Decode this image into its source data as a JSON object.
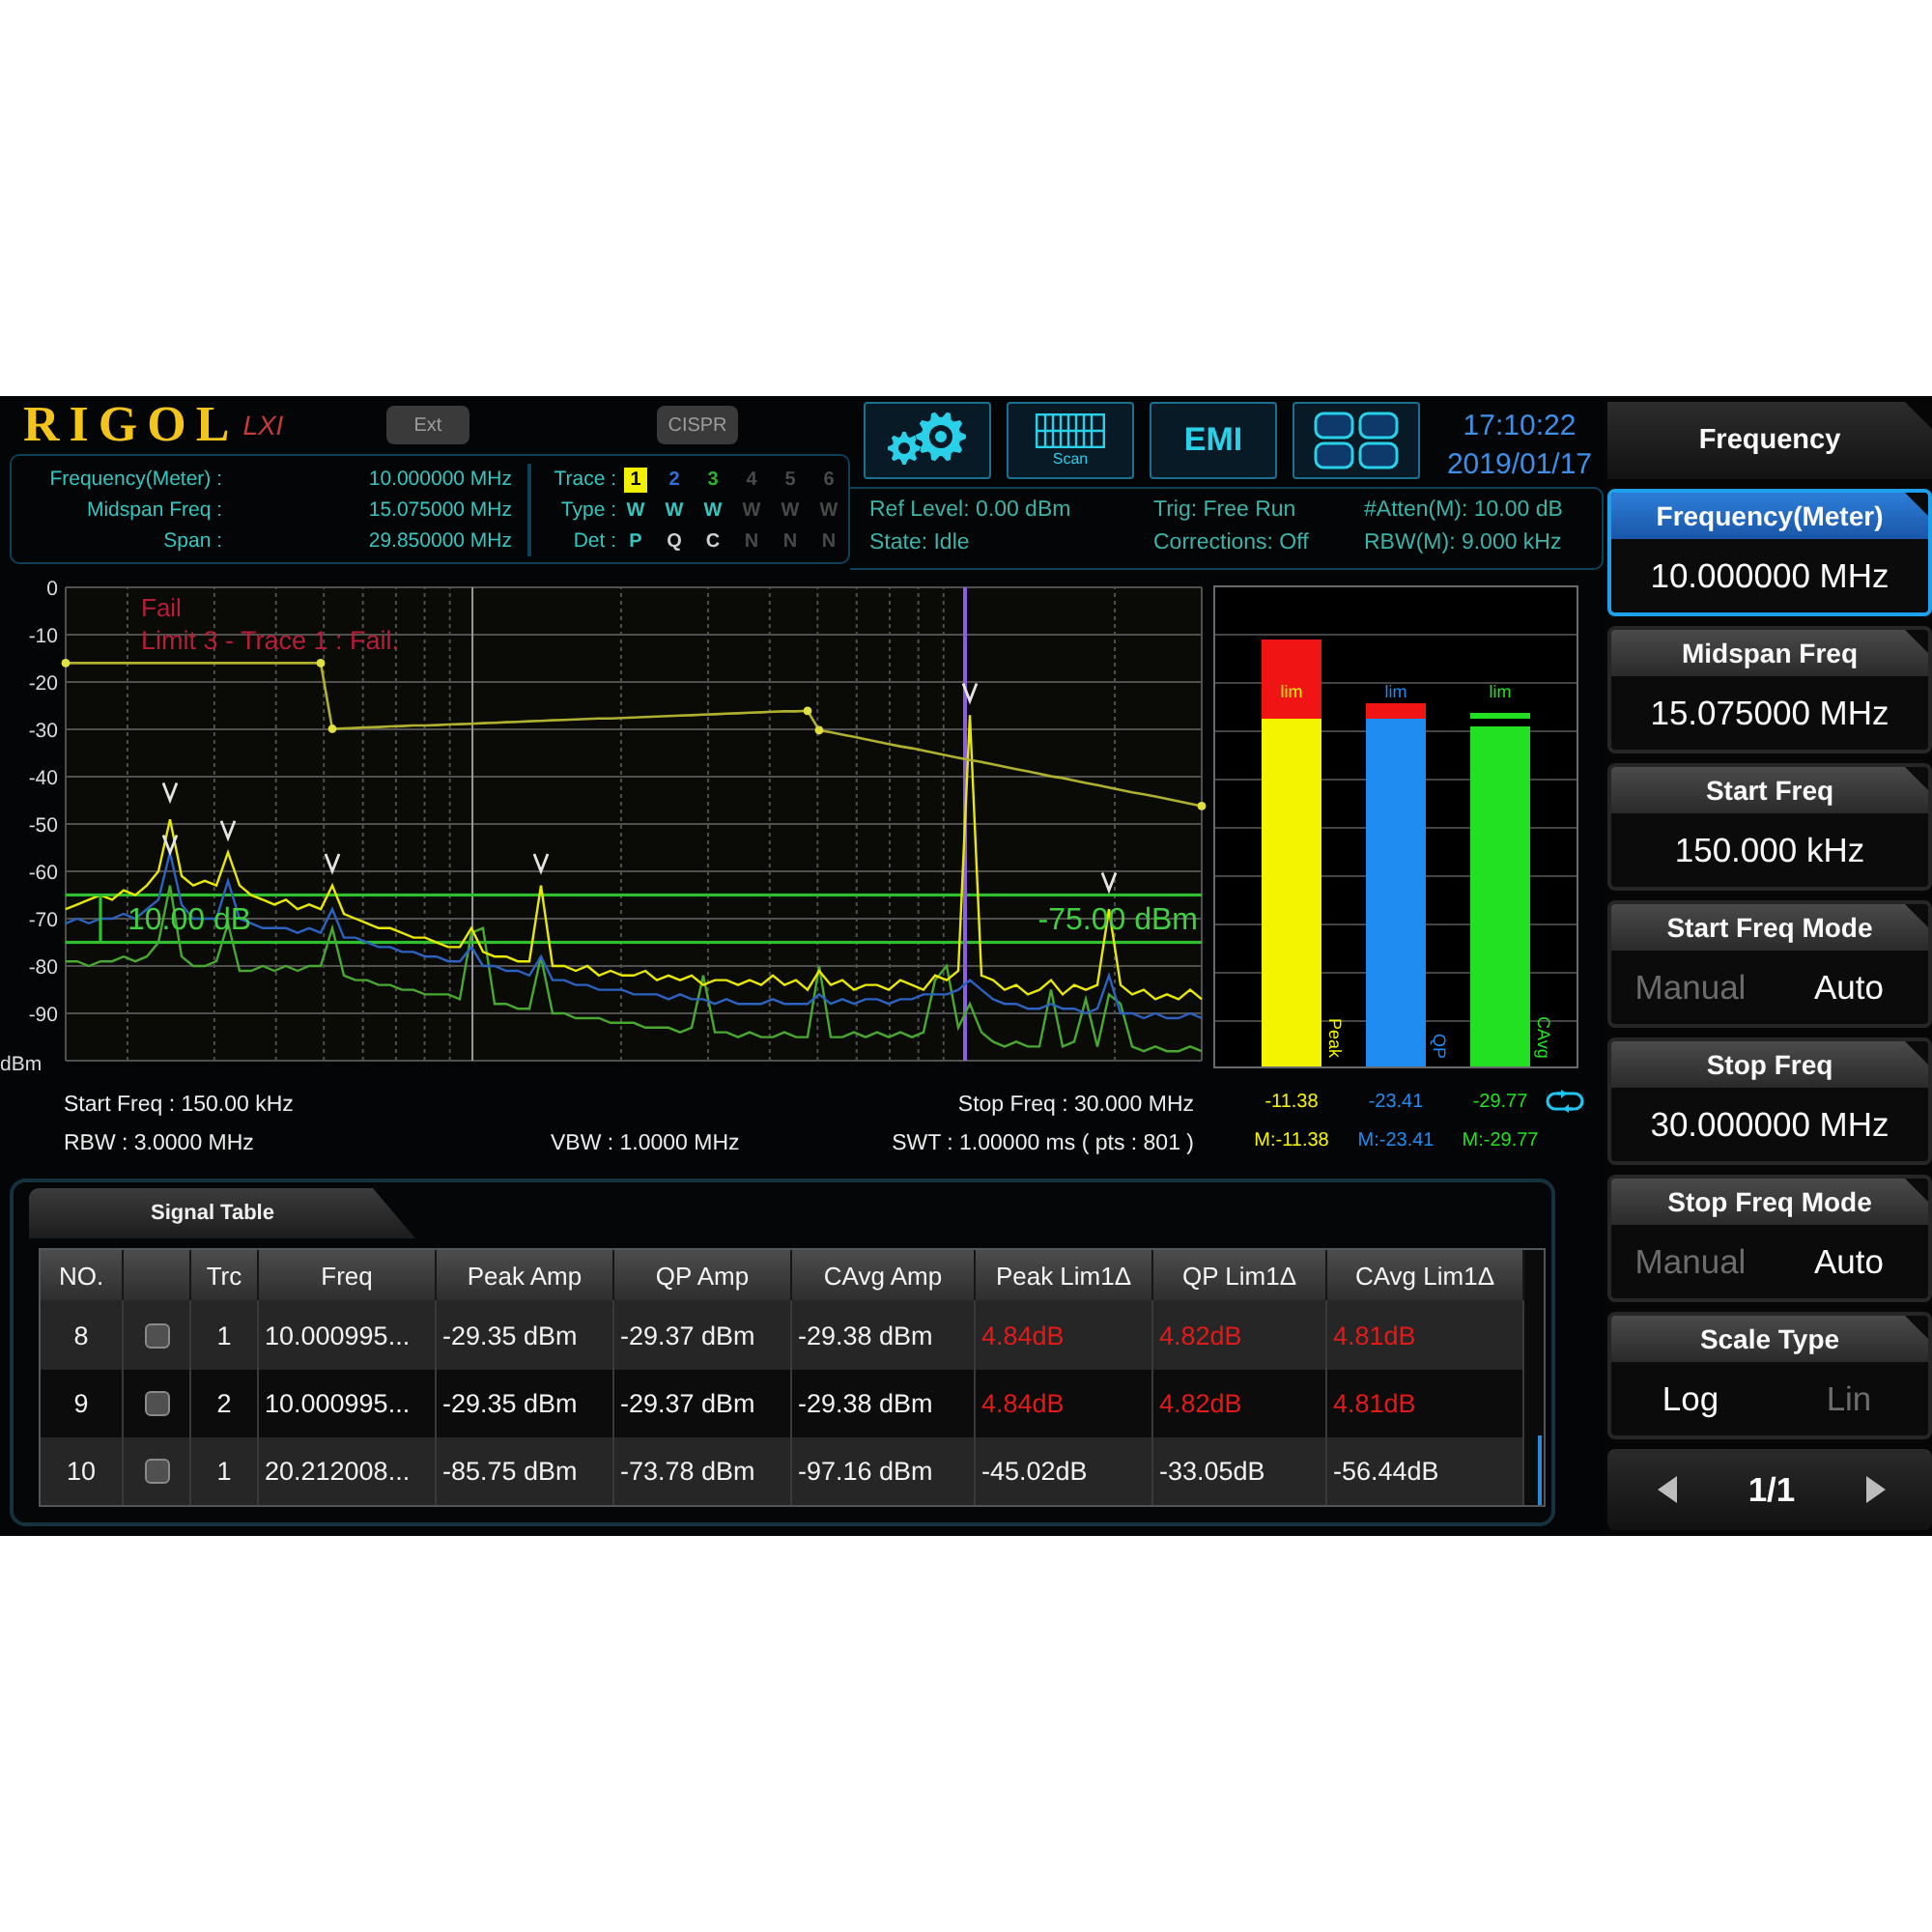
{
  "header": {
    "logo": {
      "brand": "RIGOL",
      "mark": "LXI"
    },
    "mode_buttons": [
      {
        "label": "Ext"
      },
      {
        "label": "CISPR"
      }
    ],
    "toolbar": [
      {
        "kind": "settings"
      },
      {
        "kind": "scan",
        "label": "Scan"
      },
      {
        "kind": "text",
        "label": "EMI"
      },
      {
        "kind": "layout"
      }
    ],
    "clock": {
      "time": "17:10:22",
      "date": "2019/01/17"
    },
    "readouts": [
      {
        "label": "Frequency(Meter) :",
        "value": "10.000000 MHz"
      },
      {
        "label": "Midspan Freq :",
        "value": "15.075000 MHz"
      },
      {
        "label": "Span :",
        "value": "29.850000 MHz"
      }
    ],
    "trace_table": {
      "row_labels": [
        "Trace :",
        "Type :",
        "Det :"
      ],
      "traces": [
        {
          "number": "1",
          "type": "W",
          "detector": "P",
          "color": "#f0f000",
          "on": true,
          "selected": true
        },
        {
          "number": "2",
          "type": "W",
          "detector": "Q",
          "color": "#2f6fd8",
          "on": true,
          "selected": false
        },
        {
          "number": "3",
          "type": "W",
          "detector": "C",
          "color": "#30b030",
          "on": true,
          "selected": false
        },
        {
          "number": "4",
          "type": "W",
          "detector": "N",
          "on": false,
          "selected": false
        },
        {
          "number": "5",
          "type": "W",
          "detector": "N",
          "on": false,
          "selected": false
        },
        {
          "number": "6",
          "type": "W",
          "detector": "N",
          "on": false,
          "selected": false
        }
      ]
    },
    "status": [
      [
        "Ref Level: 0.00 dBm",
        "State: Idle"
      ],
      [
        "Trig: Free Run",
        "Corrections: Off"
      ],
      [
        "#Atten(M): 10.00 dB",
        "RBW(M): 9.000 kHz"
      ]
    ]
  },
  "spectrum": {
    "verdict": "Fail",
    "limit_message": "Limit 3 - Trace 1 : Fail.",
    "delta_readout": "10.00 dB",
    "threshold_readout": "-75.00 dBm",
    "start_freq": "Start Freq : 150.00 kHz",
    "stop_freq": "Stop Freq : 30.000 MHz",
    "rbw": "RBW : 3.0000 MHz",
    "vbw": "VBW : 1.0000 MHz",
    "sweep": "SWT : 1.00000 ms ( pts : 801 )",
    "chart_data": {
      "type": "line",
      "ylabel": "dBm",
      "ylim": [
        -100,
        0
      ],
      "yticks": [
        0,
        -10,
        -20,
        -30,
        -40,
        -50,
        -60,
        -70,
        -80,
        -90
      ],
      "ref_lines": [
        {
          "axis": "y",
          "value": -65,
          "color": "#2fc02f"
        },
        {
          "axis": "y",
          "value": -75,
          "color": "#2fc02f"
        }
      ],
      "categories": [
        null,
        null,
        null,
        null,
        null,
        null,
        null,
        null,
        null,
        null,
        null,
        null,
        null,
        null,
        null,
        null,
        null,
        null,
        null,
        null,
        null,
        null,
        null,
        null,
        null,
        null,
        null,
        null,
        null,
        null,
        null,
        null,
        null,
        null,
        null,
        null,
        null,
        null,
        null,
        null,
        null,
        null,
        null,
        null,
        null,
        null,
        null,
        null,
        null,
        null,
        null,
        null,
        null,
        null,
        null,
        null,
        null,
        null,
        null,
        null,
        null,
        null,
        null,
        null,
        null,
        null,
        null,
        null,
        null,
        null,
        null,
        null,
        null,
        null,
        null,
        null,
        null,
        null,
        null,
        null,
        null,
        null,
        null,
        null,
        null,
        null,
        null,
        null,
        null,
        null,
        null,
        null,
        null,
        null,
        null,
        null,
        null,
        null,
        null
      ],
      "series": [
        {
          "color": "#48a830",
          "values": [
            -79,
            -79,
            -80,
            -79,
            -79,
            -78,
            -79,
            -78,
            -75,
            -63,
            -78,
            -80,
            -80,
            -79,
            -71,
            -81,
            -81,
            -80,
            -81,
            -80,
            -81,
            -80,
            -80,
            -72,
            -82,
            -83,
            -83,
            -84,
            -84,
            -85,
            -85,
            -86,
            -86,
            -86,
            -87,
            -73,
            -72,
            -88,
            -88,
            -89,
            -89,
            -78,
            -90,
            -90,
            -91,
            -91,
            -91,
            -92,
            -92,
            -92,
            -93,
            -93,
            -93,
            -94,
            -93,
            -82,
            -94,
            -94,
            -95,
            -94,
            -95,
            -95,
            -94,
            -95,
            -95,
            -80,
            -95,
            -95,
            -94,
            -95,
            -94,
            -95,
            -94,
            -95,
            -94,
            -83,
            -80,
            -93,
            -88,
            -94,
            -96,
            -97,
            -96,
            -97,
            -97,
            -85,
            -97,
            -96,
            -87,
            -97,
            -86,
            -88,
            -97,
            -98,
            -97,
            -98,
            -98,
            -97,
            -98
          ]
        },
        {
          "color": "#2c62c0",
          "values": [
            -71,
            -70,
            -71,
            -70,
            -70,
            -69,
            -70,
            -68,
            -66,
            -56,
            -67,
            -70,
            -70,
            -70,
            -62,
            -70,
            -71,
            -72,
            -72,
            -72,
            -73,
            -72,
            -73,
            -68,
            -74,
            -74,
            -75,
            -76,
            -76,
            -77,
            -77,
            -78,
            -78,
            -79,
            -79,
            -76,
            -80,
            -80,
            -81,
            -81,
            -82,
            -78,
            -83,
            -83,
            -84,
            -84,
            -85,
            -85,
            -85,
            -86,
            -86,
            -86,
            -87,
            -86,
            -87,
            -87,
            -88,
            -87,
            -88,
            -88,
            -88,
            -87,
            -88,
            -88,
            -88,
            -86,
            -88,
            -87,
            -88,
            -87,
            -87,
            -88,
            -87,
            -87,
            -86,
            -86,
            -86,
            -85,
            -83,
            -85,
            -87,
            -88,
            -88,
            -89,
            -89,
            -88,
            -89,
            -89,
            -90,
            -89,
            -82,
            -90,
            -90,
            -91,
            -90,
            -91,
            -91,
            -90,
            -91
          ]
        },
        {
          "color": "#e8e800",
          "values": [
            -68,
            -67,
            -66,
            -65,
            -66,
            -64,
            -65,
            -63,
            -60,
            -49,
            -61,
            -63,
            -62,
            -63,
            -56,
            -63,
            -65,
            -66,
            -67,
            -66,
            -68,
            -67,
            -68,
            -63,
            -69,
            -70,
            -71,
            -72,
            -72,
            -73,
            -74,
            -74,
            -75,
            -76,
            -76,
            -72,
            -77,
            -78,
            -78,
            -79,
            -79,
            -63,
            -80,
            -80,
            -81,
            -80,
            -82,
            -81,
            -82,
            -82,
            -81,
            -83,
            -82,
            -83,
            -82,
            -84,
            -83,
            -83,
            -84,
            -83,
            -84,
            -82,
            -84,
            -83,
            -85,
            -81,
            -84,
            -83,
            -85,
            -84,
            -84,
            -85,
            -83,
            -84,
            -85,
            -82,
            -83,
            -81,
            -27,
            -82,
            -83,
            -85,
            -84,
            -86,
            -85,
            -83,
            -86,
            -84,
            -85,
            -84,
            -68,
            -84,
            -86,
            -85,
            -87,
            -86,
            -87,
            -85,
            -87
          ]
        },
        {
          "color": "#b0b030",
          "values": [
            -16,
            -16,
            -16,
            -16,
            -16,
            -16,
            -16,
            -16,
            -16,
            -16,
            -16,
            -16,
            -16,
            -16,
            -16,
            -16,
            -16,
            -16,
            -16,
            -16,
            -16,
            -16,
            -16,
            -29.9,
            -29.8,
            -29.7,
            -29.6,
            -29.5,
            -29.4,
            -29.3,
            -29.2,
            -29.2,
            -29.1,
            -29,
            -28.9,
            -28.8,
            -28.7,
            -28.6,
            -28.5,
            -28.4,
            -28.3,
            -28.2,
            -28.1,
            -28,
            -27.9,
            -27.8,
            -27.7,
            -27.7,
            -27.6,
            -27.5,
            -27.4,
            -27.3,
            -27.2,
            -27.1,
            -27,
            -26.9,
            -26.8,
            -26.7,
            -26.6,
            -26.5,
            -26.4,
            -26.3,
            -26.2,
            -26.2,
            -26.1,
            -30.2,
            -30.6,
            -31.1,
            -31.6,
            -32.1,
            -32.6,
            -33.1,
            -33.6,
            -34,
            -34.5,
            -35,
            -35.5,
            -36,
            -36.5,
            -36.9,
            -37.4,
            -37.9,
            -38.4,
            -38.9,
            -39.4,
            -39.9,
            -40.3,
            -40.8,
            -41.3,
            -41.8,
            -42.3,
            -42.8,
            -43.3,
            -43.7,
            -44.2,
            -44.7,
            -45.2,
            -45.7,
            -46.2
          ]
        }
      ]
    }
  },
  "meters": [
    {
      "label": "Peak",
      "color": "#f4f400",
      "level": 0.89,
      "limit": {
        "label": "lim",
        "level": 0.73
      },
      "reading": "-11.38",
      "max_reading": "M:-11.38"
    },
    {
      "label": "QP",
      "color": "#1e8cf0",
      "level": 0.76,
      "limit": {
        "label": "lim",
        "level": 0.73
      },
      "reading": "-23.41",
      "max_reading": "M:-23.41"
    },
    {
      "label": "CAvg",
      "color": "#22e022",
      "level": 0.71,
      "limit": {
        "label": "lim",
        "level": 0.73
      },
      "reading": "-29.77",
      "max_reading": "M:-29.77"
    }
  ],
  "signal_table": {
    "title": "Signal Table",
    "columns": [
      {
        "kind": "text",
        "label": "NO."
      },
      {
        "kind": "checkbox"
      },
      {
        "kind": "text",
        "label": "Trc"
      },
      {
        "kind": "text",
        "label": "Freq"
      },
      {
        "kind": "text",
        "label": "Peak Amp"
      },
      {
        "kind": "text",
        "label": "QP Amp"
      },
      {
        "kind": "text",
        "label": "CAvg Amp"
      },
      {
        "kind": "text",
        "label": "Peak Lim1Δ"
      },
      {
        "kind": "text",
        "label": "QP Lim1Δ"
      },
      {
        "kind": "text",
        "label": "CAvg Lim1Δ"
      }
    ],
    "rows": [
      {
        "cells": [
          {
            "text": "8"
          },
          {
            "checked": false
          },
          {
            "text": "1"
          },
          {
            "text": "10.000995..."
          },
          {
            "text": "-29.35 dBm"
          },
          {
            "text": "-29.37 dBm"
          },
          {
            "text": "-29.38 dBm"
          },
          {
            "text": "4.84dB",
            "fail": true
          },
          {
            "text": "4.82dB",
            "fail": true
          },
          {
            "text": "4.81dB",
            "fail": true
          }
        ]
      },
      {
        "cells": [
          {
            "text": "9"
          },
          {
            "checked": false
          },
          {
            "text": "2"
          },
          {
            "text": "10.000995..."
          },
          {
            "text": "-29.35 dBm"
          },
          {
            "text": "-29.37 dBm"
          },
          {
            "text": "-29.38 dBm"
          },
          {
            "text": "4.84dB",
            "fail": true
          },
          {
            "text": "4.82dB",
            "fail": true
          },
          {
            "text": "4.81dB",
            "fail": true
          }
        ]
      },
      {
        "cells": [
          {
            "text": "10"
          },
          {
            "checked": false
          },
          {
            "text": "1"
          },
          {
            "text": "20.212008..."
          },
          {
            "text": "-85.75 dBm"
          },
          {
            "text": "-73.78 dBm"
          },
          {
            "text": "-97.16 dBm"
          },
          {
            "text": "-45.02dB",
            "fail": false
          },
          {
            "text": "-33.05dB",
            "fail": false
          },
          {
            "text": "-56.44dB",
            "fail": false
          }
        ]
      }
    ]
  },
  "menu": {
    "title": "Frequency",
    "items": [
      {
        "kind": "value",
        "label": "Frequency(Meter)",
        "value": "10.000000 MHz",
        "selected": true
      },
      {
        "kind": "value",
        "label": "Midspan Freq",
        "value": "15.075000 MHz",
        "selected": false
      },
      {
        "kind": "value",
        "label": "Start Freq",
        "value": "150.000 kHz",
        "selected": false
      },
      {
        "kind": "toggle",
        "label": "Start Freq Mode",
        "options": [
          {
            "label": "Manual",
            "selected": false
          },
          {
            "label": "Auto",
            "selected": true
          }
        ],
        "selected": false
      },
      {
        "kind": "value",
        "label": "Stop Freq",
        "value": "30.000000 MHz",
        "selected": false
      },
      {
        "kind": "toggle",
        "label": "Stop Freq Mode",
        "options": [
          {
            "label": "Manual",
            "selected": false
          },
          {
            "label": "Auto",
            "selected": true
          }
        ],
        "selected": false
      },
      {
        "kind": "toggle",
        "label": "Scale Type",
        "options": [
          {
            "label": "Log",
            "selected": true
          },
          {
            "label": "Lin",
            "selected": false
          }
        ],
        "selected": false
      }
    ],
    "pager": {
      "page": "1/1"
    }
  }
}
